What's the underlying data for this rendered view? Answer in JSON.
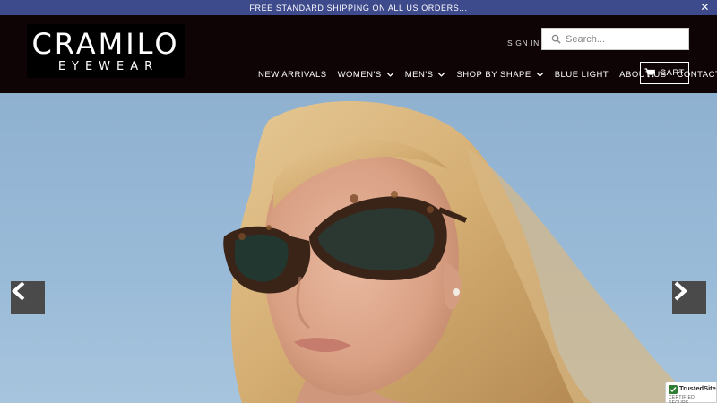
{
  "promo": {
    "text": "FREE STANDARD SHIPPING ON ALL US ORDERS...",
    "close": "✕"
  },
  "logo": {
    "main": "CRAMILO",
    "sub": "EYEWEAR"
  },
  "header": {
    "sign_in": "SIGN IN",
    "search_placeholder": "Search...",
    "cart_label": "CART"
  },
  "nav": {
    "items": [
      {
        "label": "NEW ARRIVALS",
        "dropdown": false
      },
      {
        "label": "WOMEN'S",
        "dropdown": true
      },
      {
        "label": "MEN'S",
        "dropdown": true
      },
      {
        "label": "SHOP BY SHAPE",
        "dropdown": true
      },
      {
        "label": "BLUE LIGHT",
        "dropdown": false
      },
      {
        "label": "ABOUT US",
        "dropdown": false
      },
      {
        "label": "CONTACT US",
        "dropdown": false
      }
    ]
  },
  "hero": {
    "prev_icon": "chevron-left-icon",
    "next_icon": "chevron-right-icon"
  },
  "trust_badge": {
    "name": "TrustedSite",
    "sub": "CERTIFIED SECURE"
  },
  "colors": {
    "promo_bar": "#3d4a8c",
    "header_bg": "#0e0405",
    "sky": "#9abbd8",
    "arrow_bg": "#4a4a4a"
  }
}
